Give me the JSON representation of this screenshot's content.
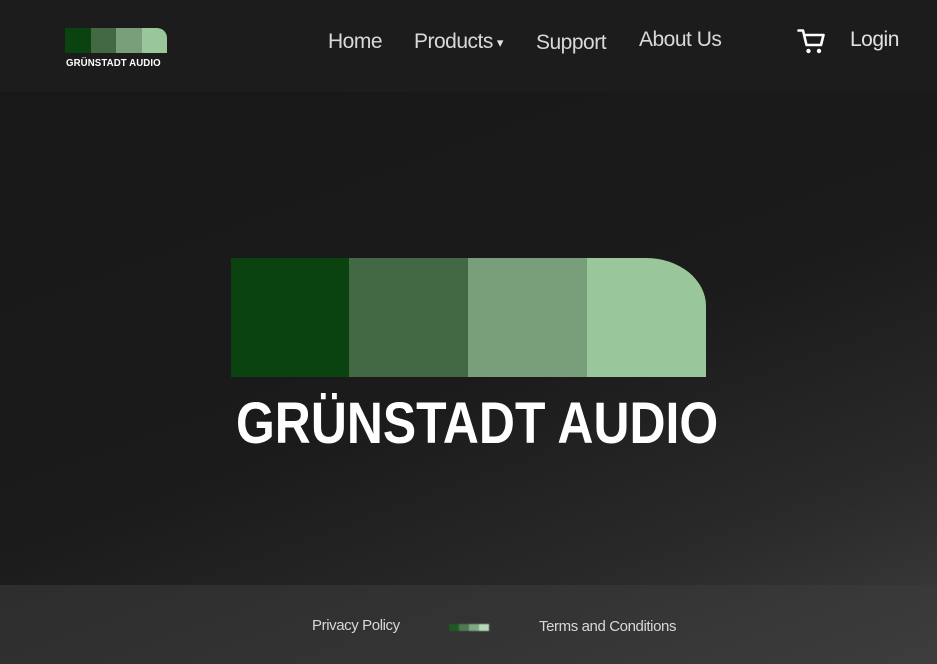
{
  "brand": {
    "name": "GRÜNSTADT AUDIO",
    "colors": [
      "#0a4210",
      "#426943",
      "#789e7a",
      "#9ac69c"
    ]
  },
  "nav": {
    "home": "Home",
    "products": "Products",
    "products_caret": "▾",
    "support": "Support",
    "about": "About Us",
    "cart_icon": "shopping-cart-icon",
    "login": "Login"
  },
  "hero": {
    "title": "GRÜNSTADT AUDIO"
  },
  "footer": {
    "privacy": "Privacy Policy",
    "terms": "Terms and Conditions"
  }
}
